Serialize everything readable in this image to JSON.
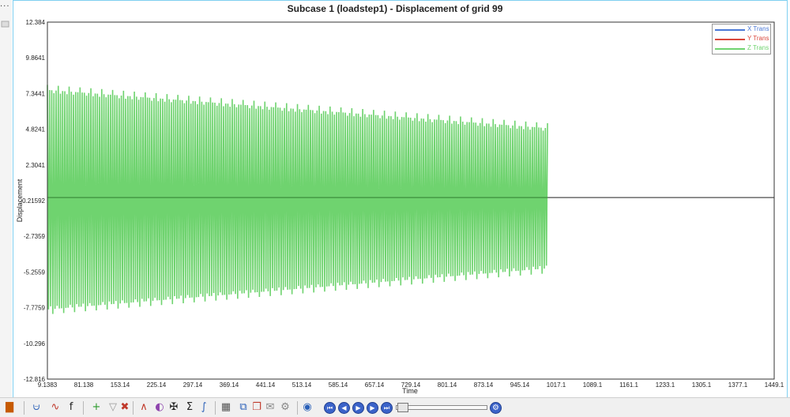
{
  "window": {
    "overflow_menu": "..."
  },
  "chart_data": {
    "type": "line",
    "title": "Subcase 1 (loadstep1) - Displacement of grid 99",
    "xlabel": "Time",
    "ylabel": "Displacement",
    "xlim": [
      9.1383,
      1449.1
    ],
    "ylim": [
      -12.816,
      12.384
    ],
    "x_ticks": [
      "9.1383",
      "81.138",
      "153.14",
      "225.14",
      "297.14",
      "369.14",
      "441.14",
      "513.14",
      "585.14",
      "657.14",
      "729.14",
      "801.14",
      "873.14",
      "945.14",
      "1017.1",
      "1089.1",
      "1161.1",
      "1233.1",
      "1305.1",
      "1377.1",
      "1449.1"
    ],
    "y_ticks": [
      "12.384",
      "9.8641",
      "7.3441",
      "4.8241",
      "2.3041",
      "-0.21592",
      "-2.7359",
      "-5.2559",
      "-7.7759",
      "-10.296",
      "-12.816"
    ],
    "grid": true,
    "legend_position": "top-right",
    "series": [
      {
        "name": "X Trans",
        "color": "#4a78d6",
        "envelope": {
          "x": [
            9.1383,
            1449.1
          ],
          "upper": [
            0,
            0
          ],
          "lower": [
            0,
            0
          ]
        }
      },
      {
        "name": "Y Trans",
        "color": "#d9473c",
        "envelope": {
          "x": [
            9.1383,
            1449.1
          ],
          "upper": [
            0,
            0
          ],
          "lower": [
            0,
            0
          ]
        }
      },
      {
        "name": "Z Trans",
        "color": "#6fd36f",
        "envelope": {
          "x": [
            9.1383,
            1000
          ],
          "upper": [
            7.6,
            4.9
          ],
          "lower": [
            -7.9,
            -5.0
          ]
        },
        "approx_cycles": 230
      }
    ]
  },
  "toolbar": {
    "icons": [
      "plot-type-icon",
      "axis-icon",
      "curve-icon",
      "function-icon",
      "add-curve-icon",
      "filter-icon",
      "delete-curve-icon",
      "peak-icon",
      "color-wheel-icon",
      "crosshair-icon",
      "sum-icon",
      "integral-icon",
      "grid-icon",
      "zoom-icon",
      "export-icon",
      "note-icon",
      "settings-gear-icon",
      "animate-icon"
    ]
  }
}
